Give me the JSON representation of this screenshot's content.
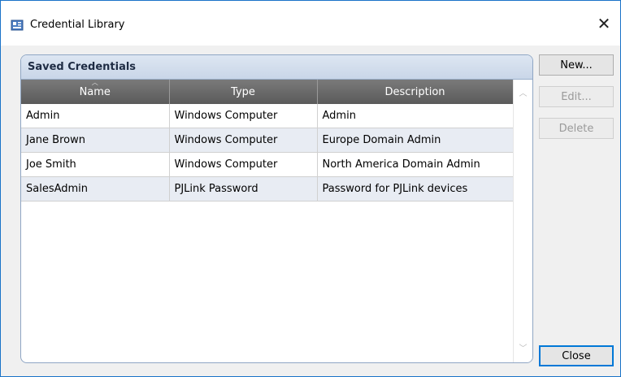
{
  "window": {
    "title": "Credential Library"
  },
  "group": {
    "title": "Saved Credentials"
  },
  "table": {
    "columns": [
      "Name",
      "Type",
      "Description"
    ],
    "rows": [
      [
        "Admin",
        "Windows Computer",
        "Admin"
      ],
      [
        "Jane Brown",
        "Windows Computer",
        "Europe Domain Admin"
      ],
      [
        "Joe Smith",
        "Windows Computer",
        "North America Domain Admin"
      ],
      [
        "SalesAdmin",
        "PJLink Password",
        "Password for PJLink devices"
      ]
    ]
  },
  "buttons": {
    "new": "New...",
    "edit": "Edit...",
    "delete": "Delete",
    "close": "Close"
  },
  "icons": {
    "app": "credential-library-icon",
    "close": "close-icon",
    "sort": "sort-ascending-icon"
  },
  "colors": {
    "header_bg": "#5a5a5a",
    "alt_row": "#e8ecf3",
    "accent": "#0078d7"
  }
}
